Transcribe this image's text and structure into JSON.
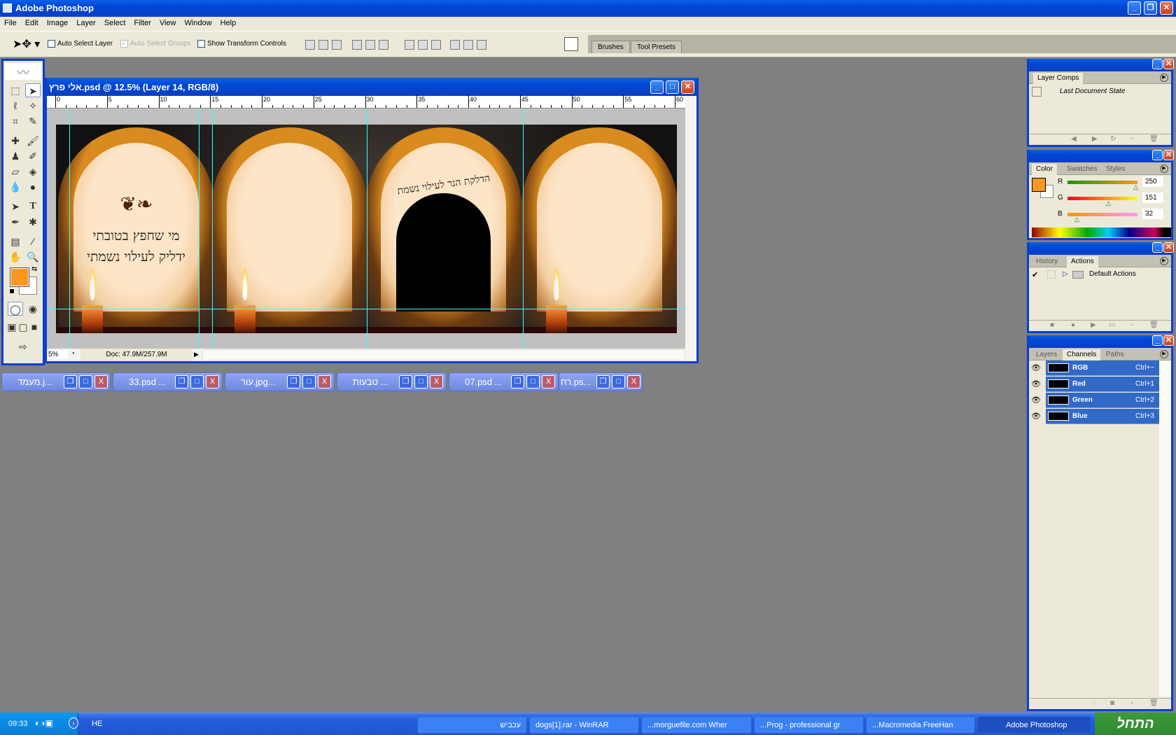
{
  "app": {
    "title": "Adobe Photoshop"
  },
  "menu": [
    "File",
    "Edit",
    "Image",
    "Layer",
    "Select",
    "Filter",
    "View",
    "Window",
    "Help"
  ],
  "options": {
    "auto_select_layer": "Auto Select Layer",
    "auto_select_groups": "Auto Select Groups",
    "show_transform_controls": "Show Transform Controls",
    "auto_select_layer_checked": false,
    "auto_select_groups_checked": true,
    "show_transform_checked": false
  },
  "well": {
    "tabs": [
      "Brushes",
      "Tool Presets"
    ]
  },
  "document": {
    "title": "אלי פרץ.psd @ 12.5% (Layer 14, RGB/8)",
    "zoom": "5%",
    "doc_size": "Doc: 47.9M/257.9M",
    "ruler_labels": [
      "0",
      "5",
      "10",
      "15",
      "20",
      "25",
      "30",
      "35",
      "40",
      "45",
      "50",
      "55",
      "60"
    ],
    "image_text": {
      "left_line1": "מי שחפץ בטובתי",
      "left_line2": "ידליק לעילוי נשמתי",
      "arch_text": "הדלקת הנר לעילוי נשמת"
    }
  },
  "foreground_color": "#fa9720",
  "background_color": "#ffffff",
  "minimized_windows": [
    "מעמד.j...",
    "33.psd ...",
    "עור.jpg...",
    "טבעות ...",
    "07.psd ...",
    "רח.ps..."
  ],
  "panels": {
    "layer_comps": {
      "tabs": [
        "Layer Comps"
      ],
      "items": [
        "Last Document State"
      ]
    },
    "color": {
      "tabs": [
        "Color",
        "Swatches",
        "Styles"
      ],
      "channels": [
        {
          "label": "R",
          "value": "250"
        },
        {
          "label": "G",
          "value": "151"
        },
        {
          "label": "B",
          "value": "32"
        }
      ]
    },
    "actions": {
      "tabs": [
        "History",
        "Actions"
      ],
      "items": [
        "Default Actions"
      ]
    },
    "channels": {
      "tabs": [
        "Layers",
        "Channels",
        "Paths"
      ],
      "items": [
        {
          "name": "RGB",
          "shortcut": "Ctrl+~"
        },
        {
          "name": "Red",
          "shortcut": "Ctrl+1"
        },
        {
          "name": "Green",
          "shortcut": "Ctrl+2"
        },
        {
          "name": "Blue",
          "shortcut": "Ctrl+3"
        }
      ]
    }
  },
  "taskbar": {
    "start": "התחל",
    "clock": "09:33",
    "lang": "HE",
    "tasks": [
      "עכביש",
      "dogs[1].rar - WinRAR",
      "...morguefile.com Wher",
      "...Prog - professional gr",
      "...Macromedia FreeHan",
      "Adobe Photoshop"
    ]
  }
}
